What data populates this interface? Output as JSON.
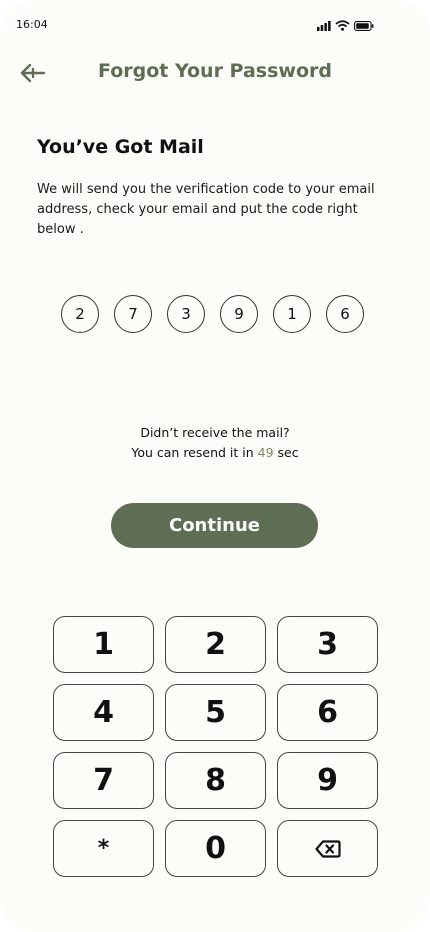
{
  "status_bar": {
    "time": "16:04",
    "icons": [
      "signal-icon",
      "wifi-icon",
      "battery-icon"
    ]
  },
  "header": {
    "back_icon": "arrow-left-icon",
    "title": "Forgot Your Password"
  },
  "content": {
    "heading": "You’ve Got Mail",
    "description": "We will send you the verification code to your email address, check your email and put the code right below ."
  },
  "code": [
    "2",
    "7",
    "3",
    "9",
    "1",
    "6"
  ],
  "resend": {
    "line1": "Didn’t receive the mail?",
    "line2_prefix": "You can resend it in",
    "countdown": "49",
    "line2_suffix": "sec"
  },
  "continue_label": "Continue",
  "keypad": {
    "keys": [
      "1",
      "2",
      "3",
      "4",
      "5",
      "6",
      "7",
      "8",
      "9",
      "*",
      "0"
    ],
    "delete_icon": "backspace-icon"
  },
  "colors": {
    "accent": "#5d6e54",
    "countdown": "#7a8b68",
    "background": "#fcfcf8"
  }
}
